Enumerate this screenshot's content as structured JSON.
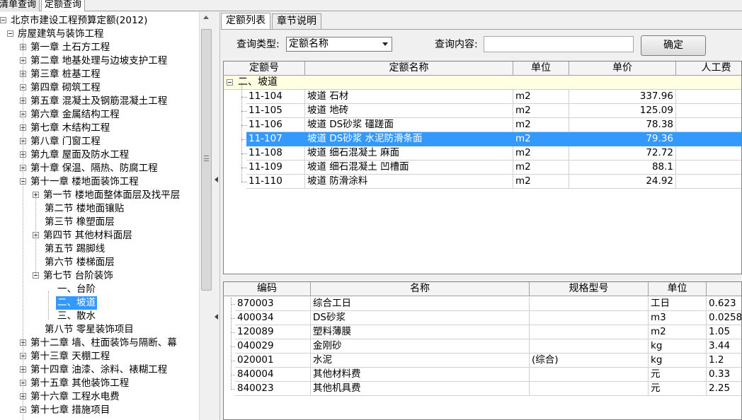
{
  "top_tabs": [
    "清单查询",
    "定额查询"
  ],
  "tree": [
    {
      "label": "北京市建设工程预算定额(2012)",
      "level": 0,
      "exp": "minus"
    },
    {
      "label": "房屋建筑与装饰工程",
      "level": 1,
      "exp": "minus"
    },
    {
      "label": "第一章  土石方工程",
      "level": 2,
      "exp": "plus"
    },
    {
      "label": "第二章  地基处理与边坡支护工程",
      "level": 2,
      "exp": "plus"
    },
    {
      "label": "第三章  桩基工程",
      "level": 2,
      "exp": "plus"
    },
    {
      "label": "第四章  砌筑工程",
      "level": 2,
      "exp": "plus"
    },
    {
      "label": "第五章  混凝土及钢筋混凝土工程",
      "level": 2,
      "exp": "plus"
    },
    {
      "label": "第六章  金属结构工程",
      "level": 2,
      "exp": "plus"
    },
    {
      "label": "第七章  木结构工程",
      "level": 2,
      "exp": "plus"
    },
    {
      "label": "第八章  门窗工程",
      "level": 2,
      "exp": "plus"
    },
    {
      "label": "第九章  屋面及防水工程",
      "level": 2,
      "exp": "plus"
    },
    {
      "label": "第十章  保温、隔热、防腐工程",
      "level": 2,
      "exp": "plus"
    },
    {
      "label": "第十一章  楼地面装饰工程",
      "level": 2,
      "exp": "minus"
    },
    {
      "label": "第一节  楼地面整体面层及找平层",
      "level": 3,
      "exp": "plus"
    },
    {
      "label": "第二节  楼地面镶贴",
      "level": 3,
      "exp": ""
    },
    {
      "label": "第三节  橡塑面层",
      "level": 3,
      "exp": ""
    },
    {
      "label": "第四节  其他材料面层",
      "level": 3,
      "exp": "plus"
    },
    {
      "label": "第五节  踢脚线",
      "level": 3,
      "exp": ""
    },
    {
      "label": "第六节  楼梯面层",
      "level": 3,
      "exp": ""
    },
    {
      "label": "第七节  台阶装饰",
      "level": 3,
      "exp": "minus"
    },
    {
      "label": "一、台阶",
      "level": 4,
      "exp": ""
    },
    {
      "label": "二、坡道",
      "level": 4,
      "exp": "",
      "selected": true
    },
    {
      "label": "三、散水",
      "level": 4,
      "exp": ""
    },
    {
      "label": "第八节  零星装饰项目",
      "level": 3,
      "exp": ""
    },
    {
      "label": "第十二章  墙、柱面装饰与隔断、幕",
      "level": 2,
      "exp": "plus"
    },
    {
      "label": "第十三章  天棚工程",
      "level": 2,
      "exp": "plus"
    },
    {
      "label": "第十四章  油漆、涂料、裱糊工程",
      "level": 2,
      "exp": "plus"
    },
    {
      "label": "第十五章  其他装饰工程",
      "level": 2,
      "exp": "plus"
    },
    {
      "label": "第十六章  工程水电费",
      "level": 2,
      "exp": "plus"
    },
    {
      "label": "第十七章  措施项目",
      "level": 2,
      "exp": "plus"
    }
  ],
  "right_tabs": [
    "定额列表",
    "章节说明"
  ],
  "query": {
    "type_label": "查询类型:",
    "type_value": "定额名称",
    "content_label": "查询内容:",
    "content_value": "",
    "confirm_label": "确定"
  },
  "quota_table": {
    "headers": [
      "定额号",
      "定额名称",
      "单位",
      "单价",
      "人工费"
    ],
    "group_label": "二、坡道",
    "rows": [
      {
        "code": "11-104",
        "name": "坡道  石材",
        "unit": "m2",
        "price": "337.96"
      },
      {
        "code": "11-105",
        "name": "坡道  地砖",
        "unit": "m2",
        "price": "125.09"
      },
      {
        "code": "11-106",
        "name": "坡道  DS砂浆  礓蹉面",
        "unit": "m2",
        "price": "78.38"
      },
      {
        "code": "11-107",
        "name": "坡道  DS砂浆  水泥防滑条面",
        "unit": "m2",
        "price": "79.36",
        "selected": true
      },
      {
        "code": "11-108",
        "name": "坡道  细石混凝土  麻面",
        "unit": "m2",
        "price": "72.72"
      },
      {
        "code": "11-109",
        "name": "坡道  细石混凝土  凹槽面",
        "unit": "m2",
        "price": "88.1"
      },
      {
        "code": "11-110",
        "name": "坡道  防滑涂料",
        "unit": "m2",
        "price": "24.92"
      }
    ]
  },
  "resource_table": {
    "headers": [
      "编码",
      "名称",
      "规格型号",
      "单位",
      ""
    ],
    "rows": [
      {
        "code": "870003",
        "name": "综合工日",
        "spec": "",
        "unit": "工日",
        "qty": "0.623"
      },
      {
        "code": "400034",
        "name": "DS砂浆",
        "spec": "",
        "unit": "m3",
        "qty": "0.0258"
      },
      {
        "code": "120089",
        "name": "塑料薄膜",
        "spec": "",
        "unit": "m2",
        "qty": "1.05"
      },
      {
        "code": "040029",
        "name": "金刚砂",
        "spec": "",
        "unit": "kg",
        "qty": "3.44"
      },
      {
        "code": "020001",
        "name": "水泥",
        "spec": "(综合)",
        "unit": "kg",
        "qty": "1.2"
      },
      {
        "code": "840004",
        "name": "其他材料费",
        "spec": "",
        "unit": "元",
        "qty": "0.33"
      },
      {
        "code": "840023",
        "name": "其他机具费",
        "spec": "",
        "unit": "元",
        "qty": "2.25"
      }
    ]
  },
  "colors": {
    "selection": "#3399ff",
    "group_row": "#ffffe1"
  }
}
